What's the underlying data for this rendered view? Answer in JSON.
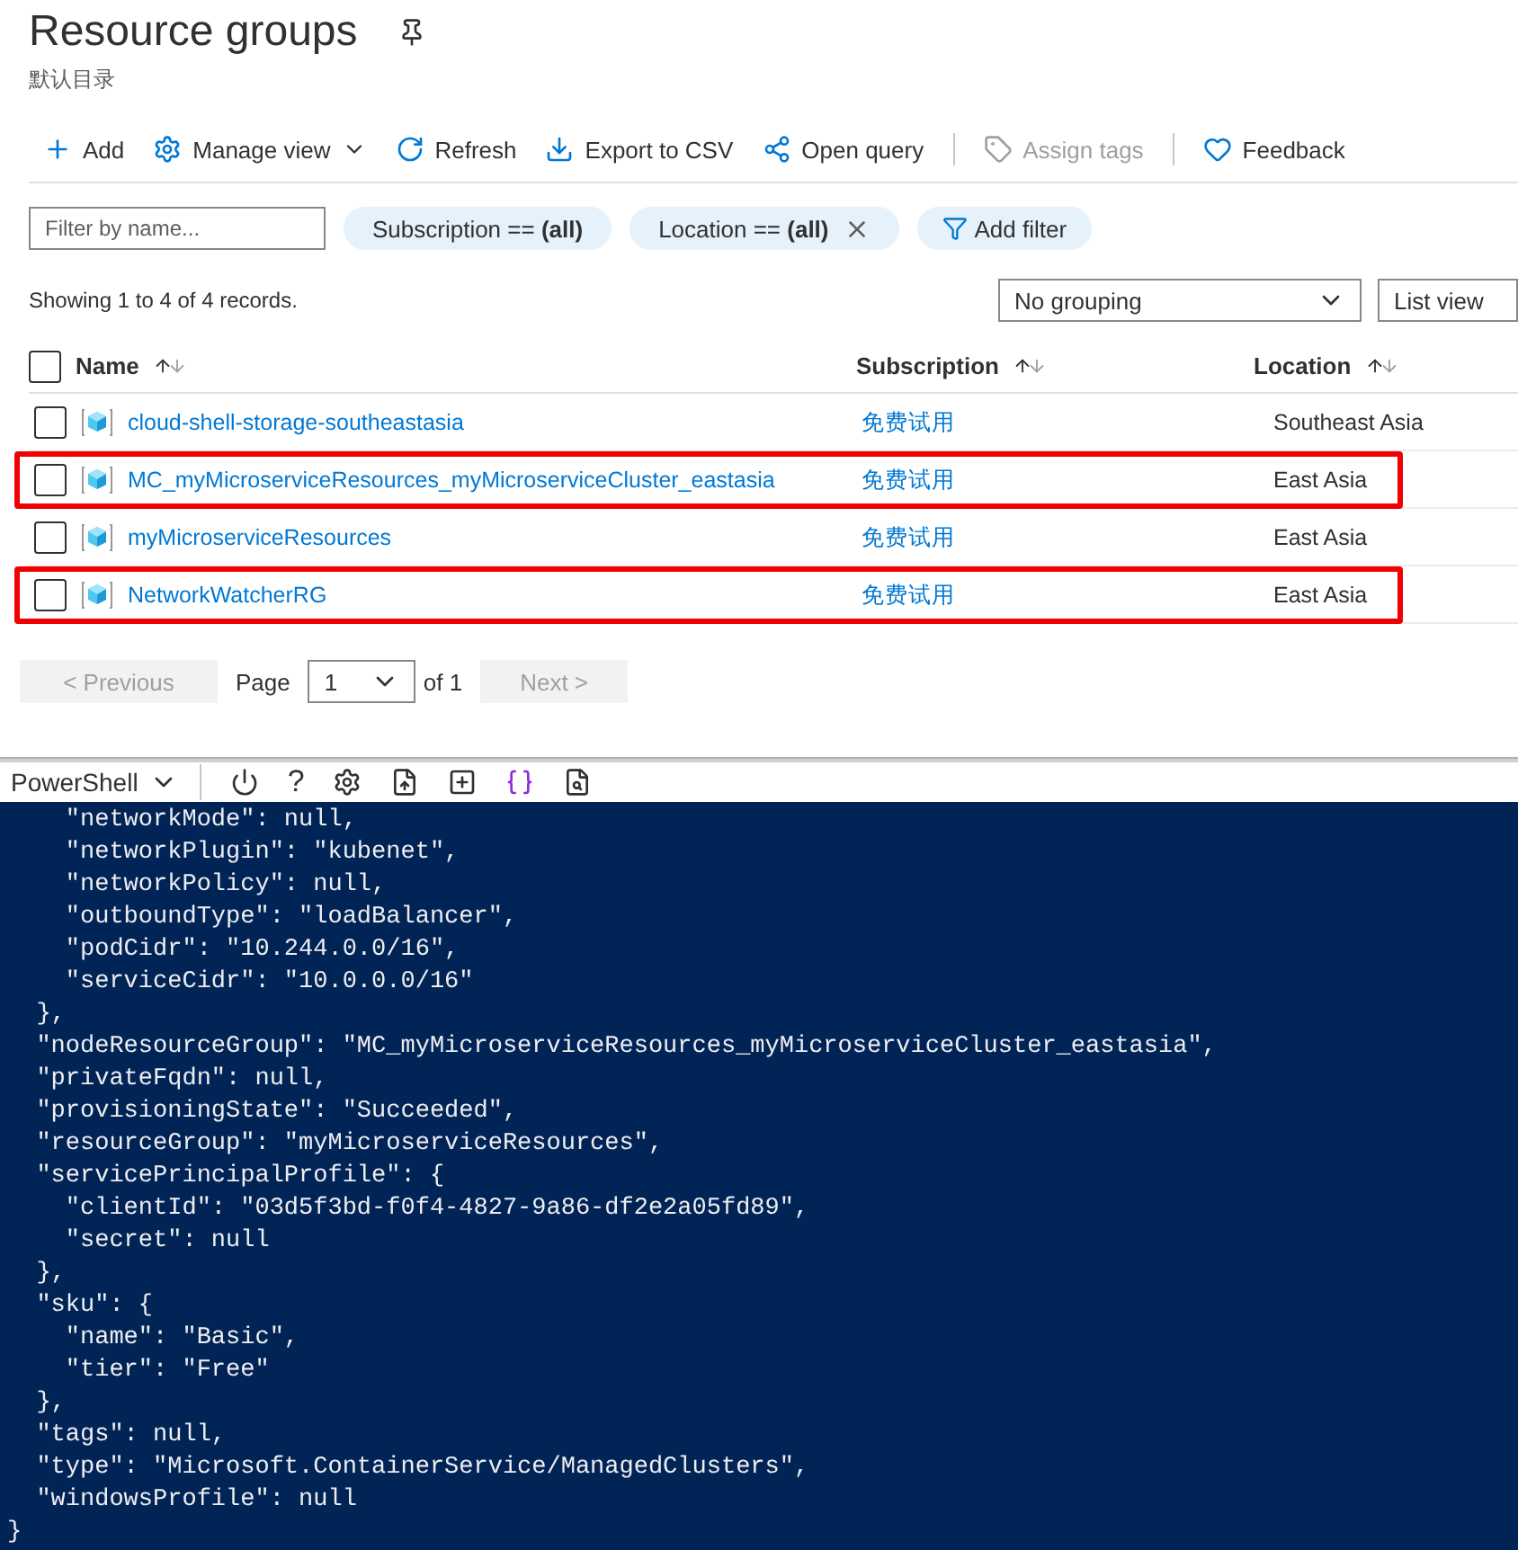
{
  "header": {
    "title": "Resource groups",
    "subtitle": "默认目录"
  },
  "toolbar": [
    {
      "label": "Add",
      "disabled": false,
      "dropdown": false
    },
    {
      "label": "Manage view",
      "disabled": false,
      "dropdown": true
    },
    {
      "label": "Refresh",
      "disabled": false,
      "dropdown": false
    },
    {
      "label": "Export to CSV",
      "disabled": false,
      "dropdown": false
    },
    {
      "label": "Open query",
      "disabled": false,
      "dropdown": false
    },
    {
      "label": "Assign tags",
      "disabled": true,
      "dropdown": false
    },
    {
      "label": "Feedback",
      "disabled": false,
      "dropdown": false
    }
  ],
  "filters": {
    "placeholder": "Filter by name...",
    "chips": [
      {
        "label": "Subscription == **(all)**",
        "removable": false
      },
      {
        "label": "Location == **(all)**",
        "removable": true
      }
    ],
    "add_label": "Add filter"
  },
  "summary": "Showing 1 to 4 of 4 records.",
  "grouping": "No grouping",
  "view": "List view",
  "table": {
    "select_all_checked": false,
    "columns": [
      "Name",
      "Subscription",
      "Location"
    ],
    "rows": [
      {
        "name": "cloud-shell-storage-southeastasia",
        "subscription": "免费试用",
        "location": "Southeast Asia",
        "checked": false,
        "highlighted": false
      },
      {
        "name": "MC_myMicroserviceResources_myMicroserviceCluster_eastasia",
        "subscription": "免费试用",
        "location": "East Asia",
        "checked": false,
        "highlighted": true
      },
      {
        "name": "myMicroserviceResources",
        "subscription": "免费试用",
        "location": "East Asia",
        "checked": false,
        "highlighted": false
      },
      {
        "name": "NetworkWatcherRG",
        "subscription": "免费试用",
        "location": "East Asia",
        "checked": false,
        "highlighted": true
      }
    ]
  },
  "pager": {
    "previous": "< Previous",
    "page_label": "Page",
    "page": "1",
    "of": "of 1",
    "next": "Next >",
    "previous_disabled": true,
    "next_disabled": true
  },
  "shell": {
    "name": "PowerShell",
    "help": "?",
    "lines": [
      "    \"networkMode\": null,",
      "    \"networkPlugin\": \"kubenet\",",
      "    \"networkPolicy\": null,",
      "    \"outboundType\": \"loadBalancer\",",
      "    \"podCidr\": \"10.244.0.0/16\",",
      "    \"serviceCidr\": \"10.0.0.0/16\"",
      "  },",
      "  \"nodeResourceGroup\": \"MC_myMicroserviceResources_myMicroserviceCluster_eastasia\",",
      "  \"privateFqdn\": null,",
      "  \"provisioningState\": \"Succeeded\",",
      "  \"resourceGroup\": \"myMicroserviceResources\",",
      "  \"servicePrincipalProfile\": {",
      "    \"clientId\": \"03d5f3bd-f0f4-4827-9a86-df2e2a05fd89\",",
      "    \"secret\": null",
      "  },",
      "  \"sku\": {",
      "    \"name\": \"Basic\",",
      "    \"tier\": \"Free\"",
      "  },",
      "  \"tags\": null,",
      "  \"type\": \"Microsoft.ContainerService/ManagedClusters\",",
      "  \"windowsProfile\": null",
      "}"
    ]
  }
}
